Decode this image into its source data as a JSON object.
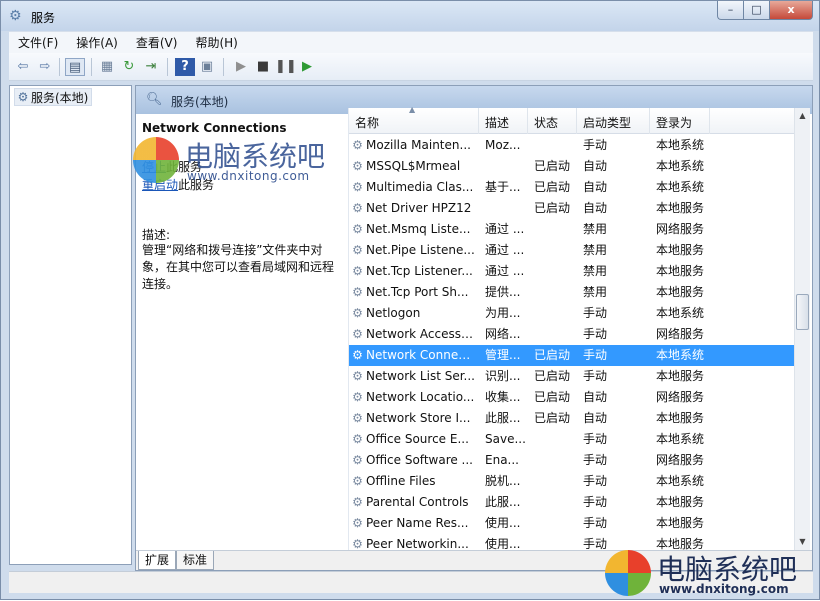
{
  "window": {
    "title": "服务",
    "min": "–",
    "max": "□",
    "close": "x"
  },
  "menu": [
    "文件(F)",
    "操作(A)",
    "查看(V)",
    "帮助(H)"
  ],
  "tree": {
    "root": "服务(本地)"
  },
  "panel": {
    "title": "服务(本地)"
  },
  "detail": {
    "service_name": "Network Connections",
    "link1_action": "停止",
    "link1_rest": "此服务",
    "link2_action": "重启动",
    "link2_rest": "此服务",
    "desc_label": "描述:",
    "desc_text": "管理“网络和拨号连接”文件夹中对象，在其中您可以查看局域网和远程连接。"
  },
  "columns": {
    "name": "名称",
    "desc": "描述",
    "status": "状态",
    "type": "启动类型",
    "logon": "登录为"
  },
  "services": [
    {
      "name": "Mozilla Mainten...",
      "desc": "Moz...",
      "status": "",
      "type": "手动",
      "logon": "本地系统"
    },
    {
      "name": "MSSQL$Mrmeal",
      "desc": "",
      "status": "已启动",
      "type": "自动",
      "logon": "本地系统"
    },
    {
      "name": "Multimedia Clas...",
      "desc": "基于...",
      "status": "已启动",
      "type": "自动",
      "logon": "本地系统"
    },
    {
      "name": "Net Driver HPZ12",
      "desc": "",
      "status": "已启动",
      "type": "自动",
      "logon": "本地服务"
    },
    {
      "name": "Net.Msmq Liste...",
      "desc": "通过 ...",
      "status": "",
      "type": "禁用",
      "logon": "网络服务"
    },
    {
      "name": "Net.Pipe Listene...",
      "desc": "通过 ...",
      "status": "",
      "type": "禁用",
      "logon": "本地服务"
    },
    {
      "name": "Net.Tcp Listener...",
      "desc": "通过 ...",
      "status": "",
      "type": "禁用",
      "logon": "本地服务"
    },
    {
      "name": "Net.Tcp Port Sh...",
      "desc": "提供...",
      "status": "",
      "type": "禁用",
      "logon": "本地服务"
    },
    {
      "name": "Netlogon",
      "desc": "为用...",
      "status": "",
      "type": "手动",
      "logon": "本地系统"
    },
    {
      "name": "Network Access ...",
      "desc": "网络...",
      "status": "",
      "type": "手动",
      "logon": "网络服务"
    },
    {
      "name": "Network Connec...",
      "desc": "管理...",
      "status": "已启动",
      "type": "手动",
      "logon": "本地系统",
      "selected": true
    },
    {
      "name": "Network List Ser...",
      "desc": "识别...",
      "status": "已启动",
      "type": "手动",
      "logon": "本地服务"
    },
    {
      "name": "Network Locatio...",
      "desc": "收集...",
      "status": "已启动",
      "type": "自动",
      "logon": "网络服务"
    },
    {
      "name": "Network Store I...",
      "desc": "此服...",
      "status": "已启动",
      "type": "自动",
      "logon": "本地服务"
    },
    {
      "name": "Office  Source E...",
      "desc": "Save...",
      "status": "",
      "type": "手动",
      "logon": "本地系统"
    },
    {
      "name": "Office Software ...",
      "desc": "Ena...",
      "status": "",
      "type": "手动",
      "logon": "网络服务"
    },
    {
      "name": "Offline Files",
      "desc": "脱机...",
      "status": "",
      "type": "手动",
      "logon": "本地系统"
    },
    {
      "name": "Parental Controls",
      "desc": "此服...",
      "status": "",
      "type": "手动",
      "logon": "本地服务"
    },
    {
      "name": "Peer Name Res...",
      "desc": "使用...",
      "status": "",
      "type": "手动",
      "logon": "本地服务"
    },
    {
      "name": "Peer Networkin...",
      "desc": "使用...",
      "status": "",
      "type": "手动",
      "logon": "本地服务"
    }
  ],
  "tabs": [
    "扩展",
    "标准"
  ],
  "watermark": {
    "zh": "电脑系统吧",
    "en": "www.dnxitong.com"
  }
}
